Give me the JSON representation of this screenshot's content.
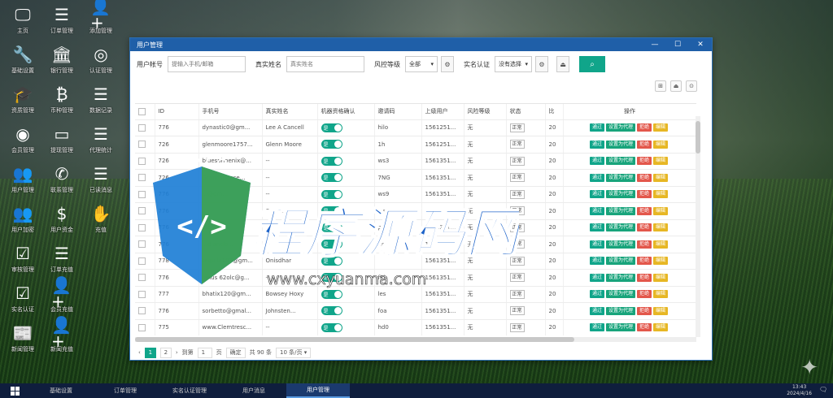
{
  "desktop": {
    "icons": [
      {
        "label": "主页",
        "icon": "monitor-icon"
      },
      {
        "label": "订单管理",
        "icon": "list-icon"
      },
      {
        "label": "添加管理",
        "icon": "add-user-icon"
      },
      {
        "label": "基础设置",
        "icon": "wrench-icon"
      },
      {
        "label": "银行管理",
        "icon": "bank-icon"
      },
      {
        "label": "认证管理",
        "icon": "circle-logo-icon"
      },
      {
        "label": "资质管理",
        "icon": "graduation-cap-icon"
      },
      {
        "label": "币种管理",
        "icon": "bitcoin-icon"
      },
      {
        "label": "数据记录",
        "icon": "list-icon"
      },
      {
        "label": "会员管理",
        "icon": "user-circle-icon"
      },
      {
        "label": "提现管理",
        "icon": "credit-card-icon"
      },
      {
        "label": "代理统计",
        "icon": "list-icon"
      },
      {
        "label": "用户管理",
        "icon": "users-icon"
      },
      {
        "label": "联系管理",
        "icon": "phone-icon"
      },
      {
        "label": "已读消息",
        "icon": "list-icon"
      },
      {
        "label": "用户加密",
        "icon": "users-icon"
      },
      {
        "label": "用户资金",
        "icon": "dollar-icon"
      },
      {
        "label": "充值",
        "icon": "hand-icon"
      },
      {
        "label": "审核管理",
        "icon": "checkbox-icon"
      },
      {
        "label": "订单充值",
        "icon": "list-icon"
      },
      {
        "label": "",
        "icon": "blank"
      },
      {
        "label": "实名认证",
        "icon": "checkbox-icon"
      },
      {
        "label": "会员充值",
        "icon": "add-user-icon"
      },
      {
        "label": "",
        "icon": "blank"
      },
      {
        "label": "新闻管理",
        "icon": "newspaper-icon"
      },
      {
        "label": "新闻充值",
        "icon": "add-user-icon"
      },
      {
        "label": "",
        "icon": "blank"
      }
    ]
  },
  "window": {
    "title": "用户管理",
    "controls": {
      "minimize": "—",
      "maximize": "☐",
      "close": "✕"
    }
  },
  "filters": {
    "account_label": "用户帐号",
    "account_placeholder": "提输入手机/邮箱",
    "name_label": "真实姓名",
    "name_placeholder": "真实姓名",
    "risk_label": "风控等级",
    "risk_value": "全部",
    "audit_label": "实名认证",
    "audit_value": "没有选择",
    "search_icon": "search-icon"
  },
  "table": {
    "columns": [
      "ID",
      "手机号",
      "真实姓名",
      "机器资格确认",
      "邀请码",
      "上级用户",
      "风险等级",
      "状态",
      "比",
      "操作"
    ],
    "ops": [
      "通过",
      "设置为代理",
      "拒绝",
      "编辑"
    ],
    "toggle_label": "是",
    "status_label": "正常",
    "rows": [
      {
        "id": "776",
        "phone": "dynastic0@gm...",
        "name": "Lee A Cancell",
        "invite": "hilo",
        "parent": "1561251...",
        "risk": "无",
        "ratio": "20"
      },
      {
        "id": "726",
        "phone": "glenmoore1757...",
        "name": "Glenn Moore",
        "invite": "1h",
        "parent": "1561251...",
        "risk": "无",
        "ratio": "20"
      },
      {
        "id": "726",
        "phone": "bluesphoenix@...",
        "name": "--",
        "invite": "ws3",
        "parent": "1561351...",
        "risk": "无",
        "ratio": "20"
      },
      {
        "id": "726",
        "phone": "Grandspanse...",
        "name": "--",
        "invite": "7NG",
        "parent": "1561351...",
        "risk": "无",
        "ratio": "20"
      },
      {
        "id": "776",
        "phone": "...@gm...",
        "name": "--",
        "invite": "ws9",
        "parent": "1561351...",
        "risk": "无",
        "ratio": "20"
      },
      {
        "id": "776",
        "phone": "...",
        "name": "Castro C.",
        "invite": "les",
        "parent": "1561351...",
        "risk": "无",
        "ratio": "20"
      },
      {
        "id": "776",
        "phone": "...co@g...",
        "name": "--",
        "invite": "ps",
        "parent": "1561351...",
        "risk": "无",
        "ratio": "20"
      },
      {
        "id": "776",
        "phone": "...dianclo...",
        "name": "--",
        "invite": "ks",
        "parent": "1561231...",
        "risk": "无",
        "ratio": "20"
      },
      {
        "id": "778",
        "phone": "tequila187@gm...",
        "name": "Onisdhar",
        "invite": "",
        "parent": "1561351...",
        "risk": "无",
        "ratio": "20"
      },
      {
        "id": "776",
        "phone": "lanus 62olc@g...",
        "name": "--",
        "invite": "fid",
        "parent": "1561351...",
        "risk": "无",
        "ratio": "20"
      },
      {
        "id": "777",
        "phone": "bhatix120@gm...",
        "name": "Bowsey Hoxy",
        "invite": "les",
        "parent": "1561351...",
        "risk": "无",
        "ratio": "20"
      },
      {
        "id": "776",
        "phone": "sorbetto@gmal...",
        "name": "Johnsten...",
        "invite": "foa",
        "parent": "1561351...",
        "risk": "无",
        "ratio": "20"
      },
      {
        "id": "775",
        "phone": "www.Clemtresc...",
        "name": "--",
        "invite": "hd0",
        "parent": "1561351...",
        "risk": "无",
        "ratio": "20"
      }
    ]
  },
  "pager": {
    "prev": "‹",
    "pages": [
      "1",
      "2"
    ],
    "next": "›",
    "goto_label": "到第",
    "goto_value": "1",
    "page_unit": "页",
    "confirm": "确定",
    "total": "共 90 条",
    "per_page": "10 条/页"
  },
  "taskbar": {
    "start_icon": "windows-icon",
    "tasks": [
      "基础设置",
      "订单管理",
      "实名认证管理",
      "用户消息",
      "用户管理"
    ],
    "active_index": 4,
    "time": "13:43",
    "date": "2024/4/16"
  },
  "watermark": {
    "title": "程序源码网",
    "url": "www.cxyuanma.com"
  },
  "colors": {
    "accent": "#10a58a",
    "title_bar": "#1f5fa8",
    "danger": "#e3574b",
    "warning": "#e7b724",
    "taskbar": "#0f1e3d"
  }
}
